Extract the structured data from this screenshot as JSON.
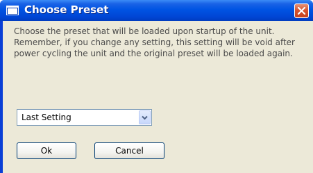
{
  "window": {
    "title": "Choose Preset",
    "message": "Choose the preset that will be loaded upon startup of the unit. Remember, if you change any setting, this setting will be void after power cycling the unit and the original preset will be loaded again."
  },
  "preset_select": {
    "selected": "Last Setting"
  },
  "buttons": {
    "ok_label": "Ok",
    "cancel_label": "Cancel"
  },
  "icons": {
    "window_icon": "window-icon",
    "close": "close-icon",
    "dropdown": "chevron-down-icon"
  },
  "colors": {
    "titlebar": "#0054e3",
    "dialog_bg": "#ece9d8",
    "close_button": "#d8542f",
    "message_text": "#4a4a4a"
  }
}
